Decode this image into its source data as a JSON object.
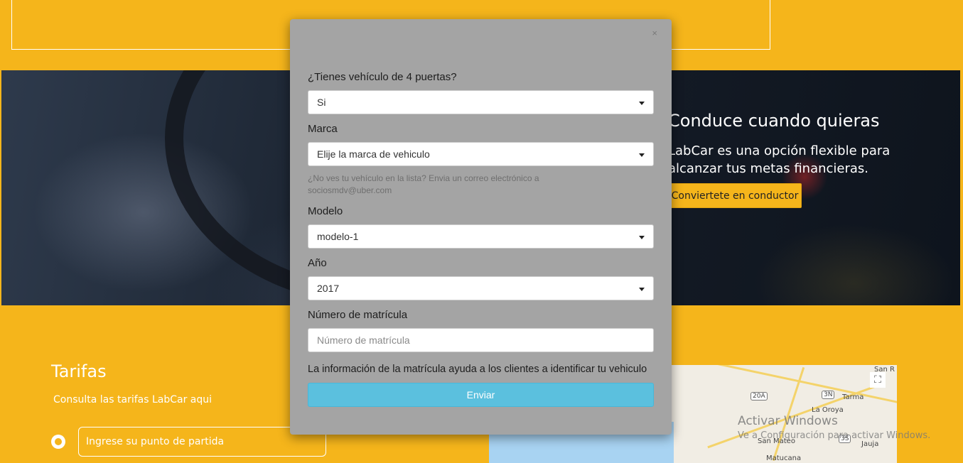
{
  "hero": {
    "title": "Conduce cuando quieras",
    "text": "LabCar es una opción flexible para alcanzar tus metas financieras.",
    "button": "Conviertete en conductor"
  },
  "tarifas": {
    "title": "Tarifas",
    "subtitle": "Consulta las tarifas LabCar aqui",
    "start_placeholder": "Ingrese su punto de partida"
  },
  "map": {
    "labels": [
      "San R",
      "Tarma",
      "La Oroya",
      "San Mateo",
      "Jauja",
      "Matucana"
    ],
    "shields": [
      "20A",
      "3N",
      "3S"
    ]
  },
  "watermark": {
    "title": "Activar Windows",
    "subtitle": "Ve a Configuración para activar Windows."
  },
  "modal": {
    "close_label": "×",
    "doors_label": "¿Tienes vehículo de 4 puertas?",
    "doors_value": "Si",
    "brand_label": "Marca",
    "brand_value": "Elije la marca de vehiculo",
    "help_text": "¿No ves tu vehículo en la lista? Envia un correo electrónico a sociosmdv@uber.com",
    "model_label": "Modelo",
    "model_value": "modelo-1",
    "year_label": "Año",
    "year_value": "2017",
    "plate_label": "Número de matrícula",
    "plate_placeholder": "Número de matrícula",
    "plate_note": "La información de la matrícula ayuda a los clientes a identificar tu vehiculo",
    "submit": "Enviar"
  },
  "colors": {
    "background": "#f5b51b",
    "modal_bg": "#a4a4a4",
    "submit_bg": "#5bc0de"
  }
}
